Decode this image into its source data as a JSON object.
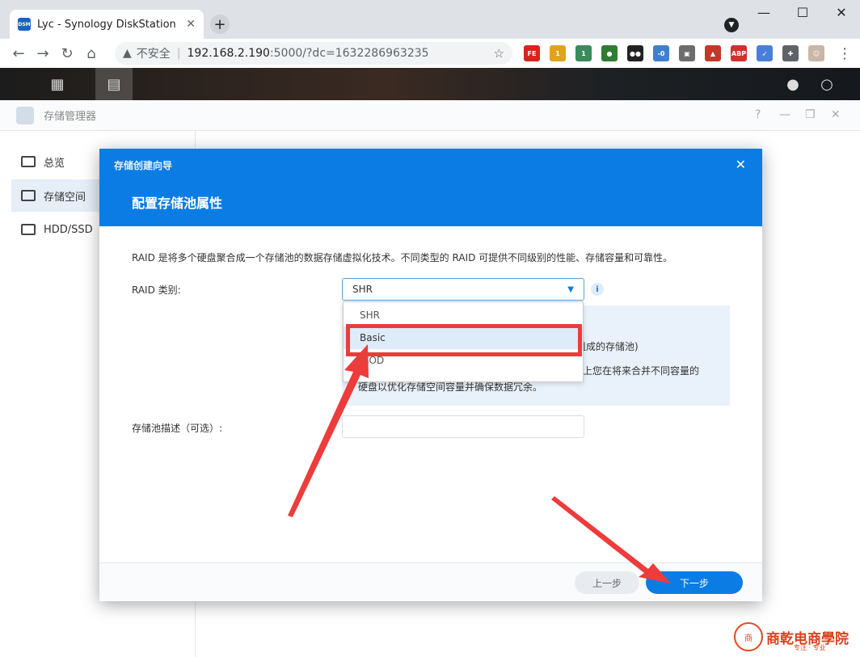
{
  "browser": {
    "tab_title": "Lyc - Synology DiskStation",
    "tab_favicon": "DSM",
    "new_tab": "+",
    "tab_close": "✕",
    "profile_icon": "▼",
    "minimize": "—",
    "maximize": "☐",
    "close": "✕",
    "back": "←",
    "forward": "→",
    "reload": "↻",
    "home": "⌂",
    "security_icon": "▲",
    "security_label": "不安全",
    "separator": "|",
    "url_host": "192.168.2.190",
    "url_path": ":5000/?dc=1632286963235",
    "bookmark_icon": "☆",
    "menu": "⋮",
    "extensions": [
      {
        "name": "FE",
        "label": "FE",
        "color": "#d9231c"
      },
      {
        "name": "badge-1",
        "label": "1",
        "color": "#e2a31c"
      },
      {
        "name": "badge-2",
        "label": "1",
        "color": "#3a8a5c"
      },
      {
        "name": "globe",
        "label": "●",
        "color": "#2e7d32"
      },
      {
        "name": "tampermonkey",
        "label": "●●",
        "color": "#222222"
      },
      {
        "name": "bracket",
        "label": "-0",
        "color": "#3f7fd0"
      },
      {
        "name": "image",
        "label": "▣",
        "color": "#6d6d6d"
      },
      {
        "name": "mountain",
        "label": "▲",
        "color": "#c0392b"
      },
      {
        "name": "abp",
        "label": "ABP",
        "color": "#d32f2f"
      },
      {
        "name": "bird",
        "label": "➶",
        "color": "#4a7fd9"
      },
      {
        "name": "puzzle",
        "label": "✚",
        "color": "#5f6368"
      },
      {
        "name": "avatar",
        "label": "☺",
        "color": "#c9b6a7"
      }
    ]
  },
  "dsm": {
    "apps_icon": "▦",
    "storage_icon": "▤",
    "user_icon": "●",
    "search_icon": "○"
  },
  "window": {
    "title": "存储管理器",
    "help": "?",
    "minimize": "—",
    "restore": "❐",
    "close": "✕",
    "sidebar": [
      {
        "label": "总览",
        "active": false
      },
      {
        "label": "存储空间",
        "active": true
      },
      {
        "label": "HDD/SSD",
        "active": false
      }
    ]
  },
  "wizard": {
    "title_small": "存储创建向导",
    "title": "配置存储池属性",
    "close": "✕",
    "description": "RAID 是将多个硬盘聚合成一个存储池的数据存储虚拟化技术。不同类型的 RAID 可提供不同级别的性能、存储容量和可靠性。",
    "raid_label": "RAID 类别:",
    "raid_value": "SHR",
    "raid_caret": "▼",
    "info_icon": "i",
    "hint_lines": [
      "组成的存储池)",
      "上您在将来合并不同容量的",
      "硬盘以优化存储空间容量并确保数据冗余。"
    ],
    "options": [
      "SHR",
      "Basic",
      "JBOD"
    ],
    "highlighted_option": 1,
    "pool_desc_label": "存储池描述（可选）:",
    "pool_desc_value": "",
    "prev_button": "上一步",
    "next_button": "下一步"
  },
  "annotations": {
    "highlight_color": "#ee3b3b",
    "watermark_logo": "商",
    "watermark_text": "商乾电商學院",
    "watermark_sub": "专注 · 专业"
  }
}
